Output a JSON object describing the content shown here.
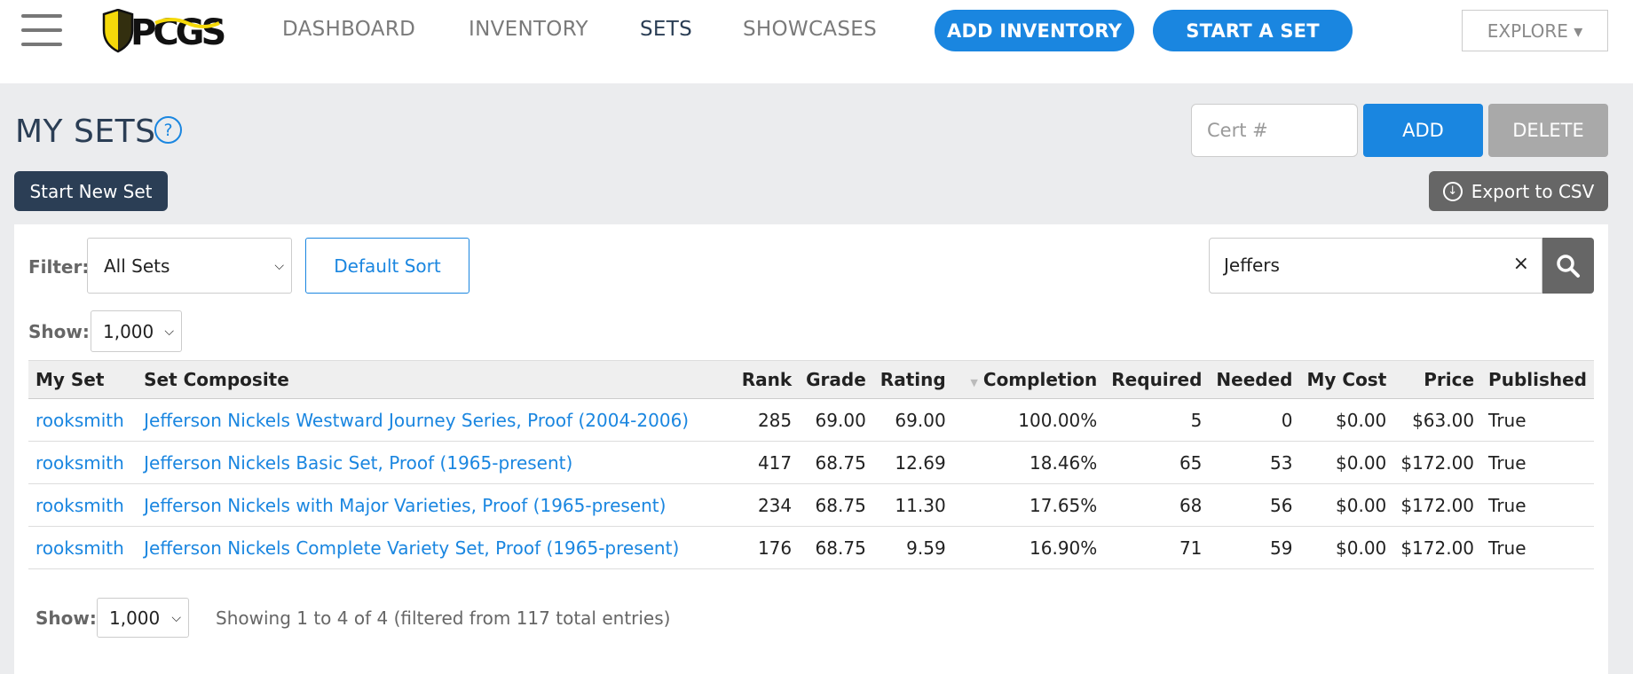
{
  "nav": {
    "items": [
      "DASHBOARD",
      "INVENTORY",
      "SETS",
      "SHOWCASES"
    ],
    "add_inventory": "ADD INVENTORY",
    "start_a_set": "START A SET",
    "explore": "EXPLORE ▾"
  },
  "colors": {
    "accent": "#1a86e0",
    "navy": "#2b3e55",
    "logo_yellow": "#f5d90a"
  },
  "page": {
    "title": "MY SETS",
    "help": "?",
    "cert_placeholder": "Cert #",
    "add": "ADD",
    "delete": "DELETE",
    "start_new_set": "Start New Set",
    "export_csv": "Export to CSV"
  },
  "filter": {
    "label": "Filter:",
    "selected": "All Sets",
    "default_sort": "Default Sort",
    "search_value": "Jeffers",
    "clear": "×"
  },
  "show": {
    "label": "Show:",
    "selected": "1,000"
  },
  "table": {
    "headers": [
      "My Set",
      "Set Composite",
      "Rank",
      "Grade",
      "Rating",
      "Completion",
      "Required",
      "Needed",
      "My Cost",
      "Price",
      "Published"
    ],
    "rows": [
      [
        "rooksmith",
        "Jefferson Nickels Westward Journey Series, Proof (2004-2006)",
        "285",
        "69.00",
        "69.00",
        "100.00%",
        "5",
        "0",
        "$0.00",
        "$63.00",
        "True"
      ],
      [
        "rooksmith",
        "Jefferson Nickels Basic Set, Proof (1965-present)",
        "417",
        "68.75",
        "12.69",
        "18.46%",
        "65",
        "53",
        "$0.00",
        "$172.00",
        "True"
      ],
      [
        "rooksmith",
        "Jefferson Nickels with Major Varieties, Proof (1965-present)",
        "234",
        "68.75",
        "11.30",
        "17.65%",
        "68",
        "56",
        "$0.00",
        "$172.00",
        "True"
      ],
      [
        "rooksmith",
        "Jefferson Nickels Complete Variety Set, Proof (1965-present)",
        "176",
        "68.75",
        "9.59",
        "16.90%",
        "71",
        "59",
        "$0.00",
        "$172.00",
        "True"
      ]
    ]
  },
  "footer": {
    "info": "Showing 1 to 4 of 4 (filtered from 117 total entries)"
  }
}
